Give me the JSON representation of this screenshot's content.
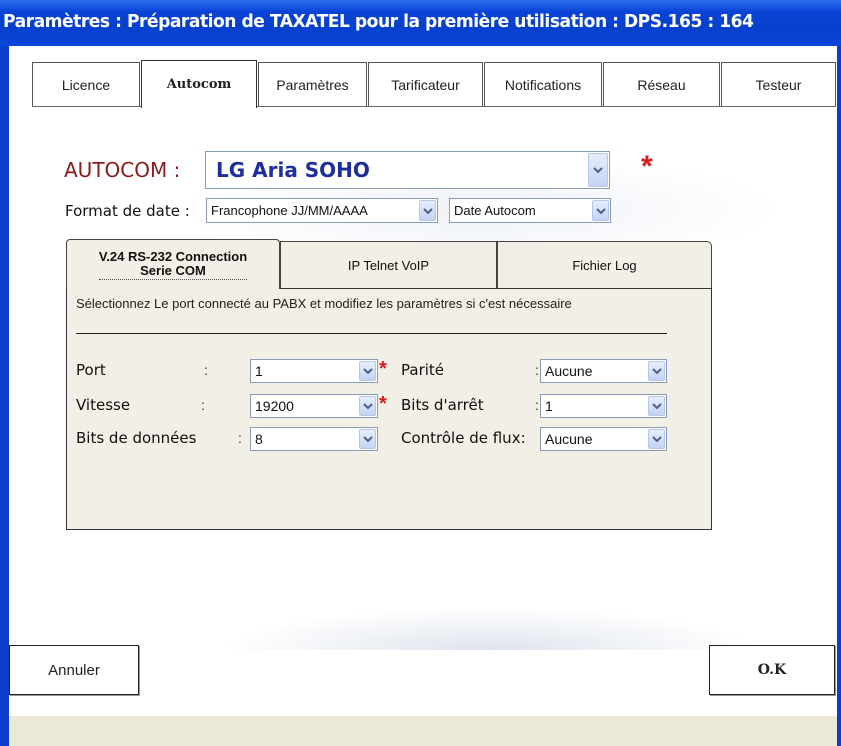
{
  "window": {
    "title": "Paramètres : Préparation de TAXATEL pour la première utilisation : DPS.165 : 164"
  },
  "tabs": [
    {
      "label": "Licence"
    },
    {
      "label": "Autocom"
    },
    {
      "label": "Paramètres"
    },
    {
      "label": "Tarificateur"
    },
    {
      "label": "Notifications"
    },
    {
      "label": "Réseau"
    },
    {
      "label": "Testeur"
    }
  ],
  "active_tab": "Autocom",
  "autocom": {
    "label": "AUTOCOM :",
    "value": "LG Aria SOHO",
    "required_mark": "*"
  },
  "date_format": {
    "label": "Format de date :",
    "value": "Francophone JJ/MM/AAAA",
    "source_value": "Date Autocom"
  },
  "connection_tabs": [
    {
      "line1": "V.24 RS-232 Connection",
      "line2": "Serie COM"
    },
    {
      "label": "IP Telnet VoIP"
    },
    {
      "label": "Fichier Log"
    }
  ],
  "serial": {
    "description": "Sélectionnez Le port connecté au PABX et modifiez les paramètres si c'est nécessaire",
    "port": {
      "label": "Port",
      "value": "1"
    },
    "speed": {
      "label": "Vitesse",
      "value": "19200"
    },
    "data_bits": {
      "label": "Bits de données",
      "value": "8"
    },
    "parity": {
      "label": "Parité",
      "value": "Aucune"
    },
    "stop_bits": {
      "label": "Bits d'arrêt",
      "value": "1"
    },
    "flow_control": {
      "label": "Contrôle de flux:",
      "value": "Aucune"
    },
    "colon": ":",
    "required_mark": "*"
  },
  "buttons": {
    "cancel": "Annuler",
    "ok": "O.K"
  },
  "colors": {
    "title_bar": "#0a43d6",
    "autocom_label": "#8b1a1a",
    "autocom_value": "#1e2e9c",
    "required": "#e21a1a",
    "panel_bg": "#f1efe6"
  }
}
